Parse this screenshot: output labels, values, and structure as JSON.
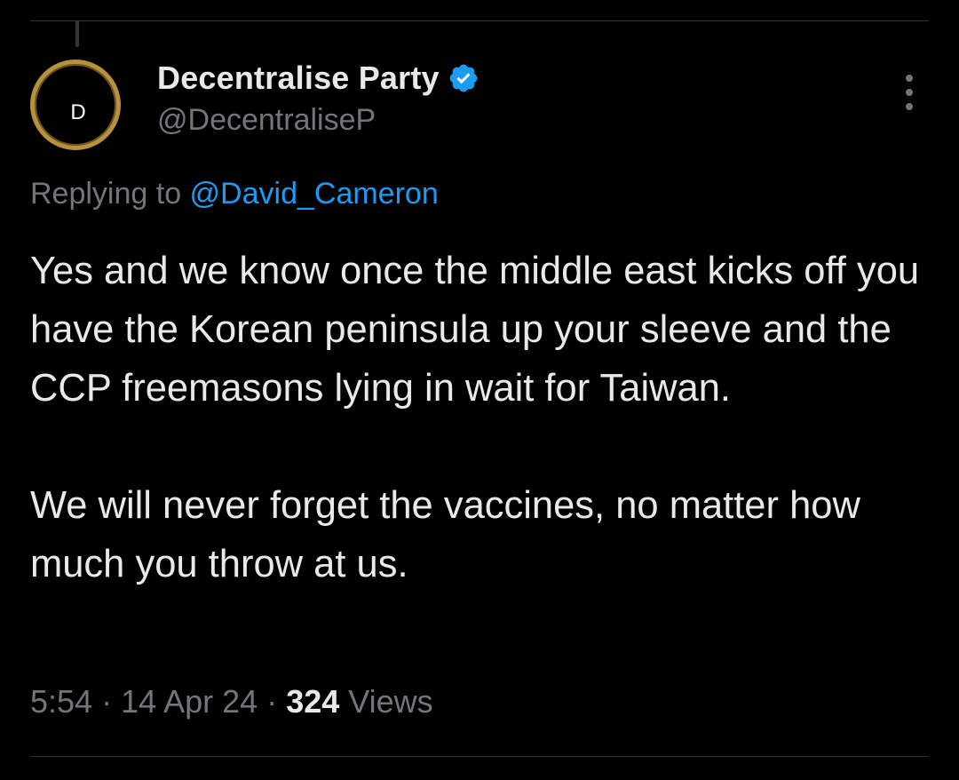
{
  "colors": {
    "background": "#000000",
    "text_primary": "#e7e9ea",
    "text_secondary": "#71767b",
    "link": "#1d9bf0",
    "verified_badge": "#1d9bf0",
    "divider": "#2f3336",
    "avatar_ring": "#b8913b"
  },
  "author": {
    "avatar_letter": "D",
    "display_name": "Decentralise Party",
    "verified": true,
    "verified_icon": "verified-badge-icon",
    "handle": "@DecentraliseP"
  },
  "more_menu_icon": "vertical-ellipsis-icon",
  "reply_context": {
    "prefix": "Replying to ",
    "mention": "@David_Cameron"
  },
  "tweet": {
    "paragraphs": [
      "Yes and we know once the middle east kicks off you have the Korean peninsula up your sleeve and the CCP freemasons lying in wait for Taiwan.",
      "We will never forget the vaccines, no matter how much you throw at us."
    ]
  },
  "meta": {
    "time": "5:54",
    "separator": " · ",
    "date": "14 Apr 24",
    "views_count": "324",
    "views_label": " Views"
  }
}
